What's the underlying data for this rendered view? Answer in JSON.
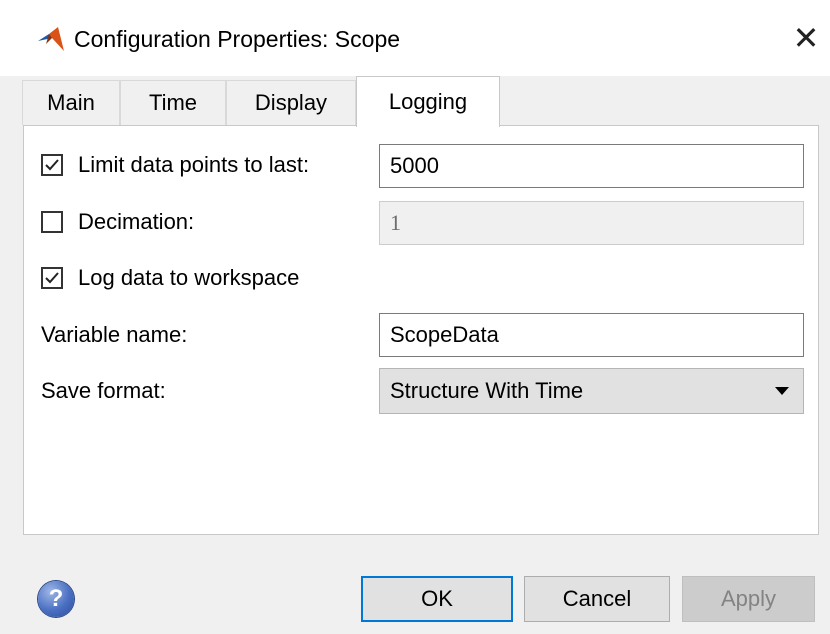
{
  "window": {
    "title": "Configuration Properties: Scope",
    "close_glyph": "✕"
  },
  "tabs": [
    {
      "label": "Main"
    },
    {
      "label": "Time"
    },
    {
      "label": "Display"
    },
    {
      "label": "Logging",
      "active": true
    }
  ],
  "logging": {
    "limit_points": {
      "label": "Limit data points to last:",
      "checked": true,
      "value": "5000"
    },
    "decimation": {
      "label": "Decimation:",
      "checked": false,
      "value": "1",
      "disabled": true
    },
    "log_to_workspace": {
      "label": "Log data to workspace",
      "checked": true
    },
    "variable_name": {
      "label": "Variable name:",
      "value": "ScopeData"
    },
    "save_format": {
      "label": "Save format:",
      "value": "Structure With Time"
    }
  },
  "footer": {
    "help_glyph": "?",
    "ok": "OK",
    "cancel": "Cancel",
    "apply": "Apply"
  },
  "colors": {
    "accent": "#0078d7",
    "matlab_orange": "#d95319",
    "help_blue": "#4a6fc2"
  }
}
